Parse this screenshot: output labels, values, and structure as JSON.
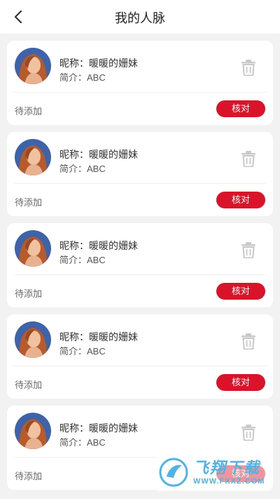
{
  "header": {
    "title": "我的人脉",
    "back_icon": "chevron-left-icon"
  },
  "contacts": [
    {
      "nickname_label": "昵称：",
      "nickname": "暖暖的姗妹",
      "bio_label": "简介：",
      "bio": "ABC",
      "status": "待添加",
      "action_label": "核对"
    },
    {
      "nickname_label": "昵称：",
      "nickname": "暖暖的姗妹",
      "bio_label": "简介：",
      "bio": "ABC",
      "status": "待添加",
      "action_label": "核对"
    },
    {
      "nickname_label": "昵称：",
      "nickname": "暖暖的姗妹",
      "bio_label": "简介：",
      "bio": "ABC",
      "status": "待添加",
      "action_label": "核对"
    },
    {
      "nickname_label": "昵称：",
      "nickname": "暖暖的姗妹",
      "bio_label": "简介：",
      "bio": "ABC",
      "status": "待添加",
      "action_label": "核对"
    },
    {
      "nickname_label": "昵称：",
      "nickname": "暖暖的姗妹",
      "bio_label": "简介：",
      "bio": "ABC",
      "status": "待添加",
      "action_label": "核对"
    }
  ],
  "watermark": {
    "brand": "飞翔下载",
    "url": "WWW.FXXZ.COM"
  },
  "colors": {
    "accent": "#d9142a",
    "background": "#f2f2f2",
    "card": "#ffffff",
    "trash_icon": "#c8c8c8",
    "watermark": "#4fb3e8"
  }
}
